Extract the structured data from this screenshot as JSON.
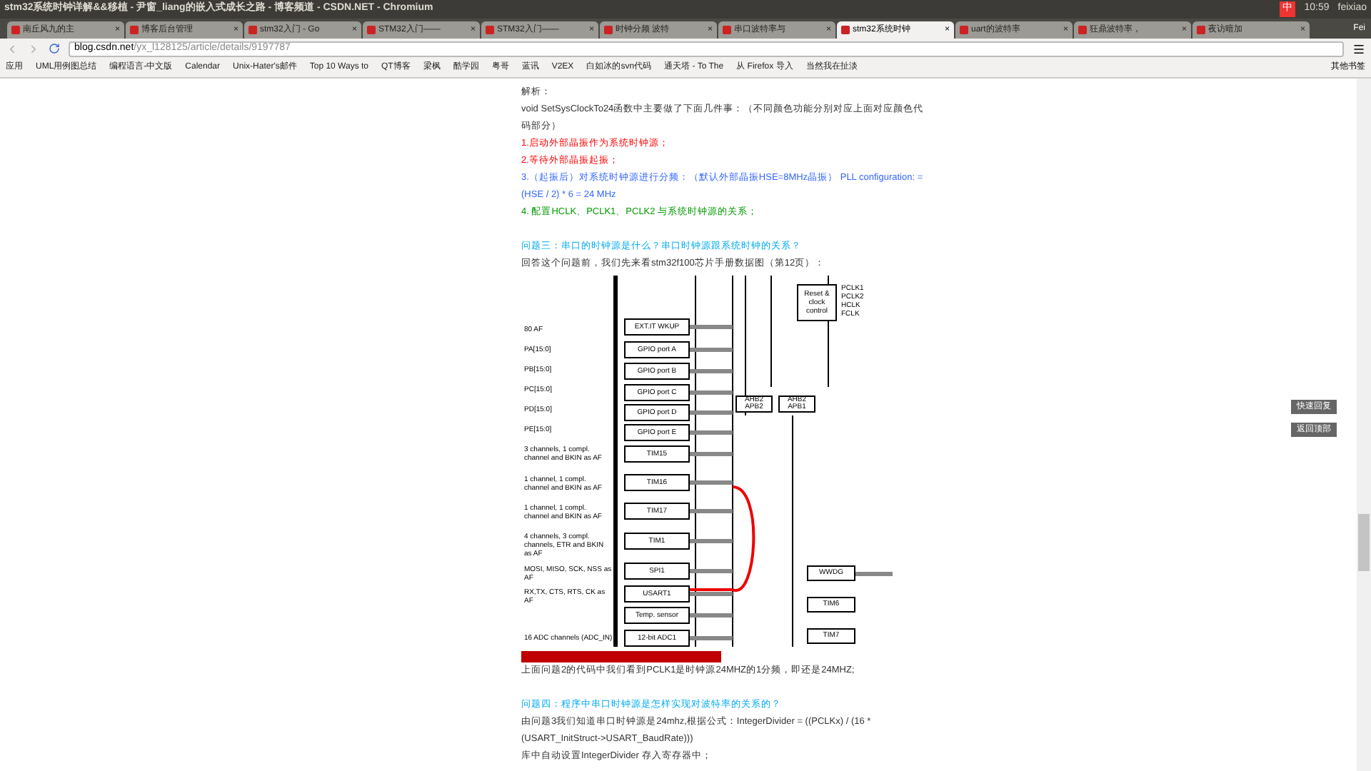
{
  "window": {
    "title": "stm32系统时钟详解&&移植 - 尹窗_liang的嵌入式成长之路 - 博客频道 - CSDN.NET - Chromium"
  },
  "system_tray": {
    "input_method": "中",
    "time": "10:59",
    "user": "feixiao"
  },
  "profile": {
    "name": "Fei"
  },
  "tab_close": "×",
  "tabs": [
    {
      "label": "南丘风九的主",
      "selected": false
    },
    {
      "label": "博客后台管理",
      "selected": false
    },
    {
      "label": "stm32入门 - Go",
      "selected": false
    },
    {
      "label": "STM32入门——",
      "selected": false
    },
    {
      "label": "STM32入门——",
      "selected": false
    },
    {
      "label": "时钟分频 波特",
      "selected": false
    },
    {
      "label": "串口波特率与",
      "selected": false
    },
    {
      "label": "stm32系统时钟",
      "selected": true
    },
    {
      "label": "uart的波特率",
      "selected": false
    },
    {
      "label": "狂鼎波特率，",
      "selected": false
    },
    {
      "label": "夜访暗加",
      "selected": false
    }
  ],
  "address_bar": {
    "host": "blog.csdn.net",
    "path": "/yx_l128125/article/details/9197787"
  },
  "bookmarks": [
    {
      "label": "应用"
    },
    {
      "label": "UML用例图总结"
    },
    {
      "label": "编程语言-中文版"
    },
    {
      "label": "Calendar"
    },
    {
      "label": "Unix-Hater's邮件"
    },
    {
      "label": "Top 10 Ways to"
    },
    {
      "label": "QT博客"
    },
    {
      "label": "梁枫"
    },
    {
      "label": "酷学园"
    },
    {
      "label": "粤哥"
    },
    {
      "label": "蓝讯"
    },
    {
      "label": "V2EX"
    },
    {
      "label": "白如冰的svn代码"
    },
    {
      "label": "通天塔 - To The"
    },
    {
      "label": "从 Firefox 导入"
    },
    {
      "label": "当然我在扯淡"
    }
  ],
  "other_bookmarks": "其他书签",
  "article": {
    "paragraphs_top": [
      {
        "text": "解析：",
        "color": "#333333"
      },
      {
        "text": "void SetSysClockTo24函数中主要做了下面几件事：（不同颜色功能分别对应上面对应颜色代码部分）",
        "color": "#333333"
      },
      {
        "text": "1.启动外部晶振作为系统时钟源；",
        "color": "#ff0000"
      },
      {
        "text": "2.等待外部晶振起振；",
        "color": "#ff0000"
      },
      {
        "text": "3.（起振后）对系统时钟源进行分频：（默认外部晶振HSE=8MHz晶振） PLL configuration: = (HSE / 2) * 6 = 24 MHz",
        "color": "#3366ff"
      },
      {
        "text": "4. 配置HCLK、PCLK1、PCLK2 与系统时钟源的关系；",
        "color": "#009900"
      },
      {
        "text": "问题三：串口的时钟源是什么？串口时钟源跟系统时钟的关系？",
        "color": "#00aaee",
        "kind": "question"
      },
      {
        "text": "回答这个问题前，我们先来看stm32f100芯片手册数据图（第12页）：",
        "color": "#333333"
      }
    ],
    "figure": {
      "left_labels": [
        "80 AF",
        "PA[15:0]",
        "PB[15:0]",
        "PC[15:0]",
        "PD[15:0]",
        "PE[15:0]",
        "3 channels, 1 compl. channel and BKIN as AF",
        "1 channel, 1 compl. channel and BKIN as AF",
        "1 channel, 1 compl. channel and BKIN as AF",
        "4 channels, 3 compl. channels, ETR and BKIN as AF",
        "MOSI, MISO, SCK, NSS as AF",
        "RX,TX, CTS, RTS, CK as AF",
        "16 ADC channels (ADC_IN)"
      ],
      "blocks": [
        "EXT.IT WKUP",
        "GPIO port A",
        "GPIO port B",
        "GPIO port C",
        "GPIO port D",
        "GPIO port E",
        "TIM15",
        "TIM16",
        "TIM17",
        "TIM1",
        "SPI1",
        "USART1",
        "Temp. sensor",
        "12-bit ADC1"
      ],
      "clock_block": "Reset & clock control",
      "clocks": [
        "PCLK1",
        "PCLK2",
        "HCLK",
        "FCLK"
      ],
      "bridges": [
        "AHB2 APB2",
        "AHB2 APB1"
      ],
      "right_blocks": [
        "WWDG",
        "TIM6",
        "TIM7"
      ]
    },
    "paragraphs_bottom": [
      {
        "text": "上面问题2的代码中我们看到PCLK1是时钟源24MHZ的1分频，即还是24MHZ;",
        "color": "#333333"
      },
      {
        "text": "问题四：程序中串口时钟源是怎样实现对波特率的关系的？",
        "color": "#00aaee",
        "kind": "question"
      },
      {
        "text": "由问题3我们知道串口时钟源是24mhz,根据公式：IntegerDivider = ((PCLKx) / (16 * (USART_InitStruct->USART_BaudRate)))",
        "color": "#333333"
      },
      {
        "text": "库中自动设置IntegerDivider 存入寄存器中；",
        "color": "#333333"
      }
    ]
  },
  "side_buttons": [
    {
      "label": "快速回复"
    },
    {
      "label": "返回顶部"
    }
  ]
}
